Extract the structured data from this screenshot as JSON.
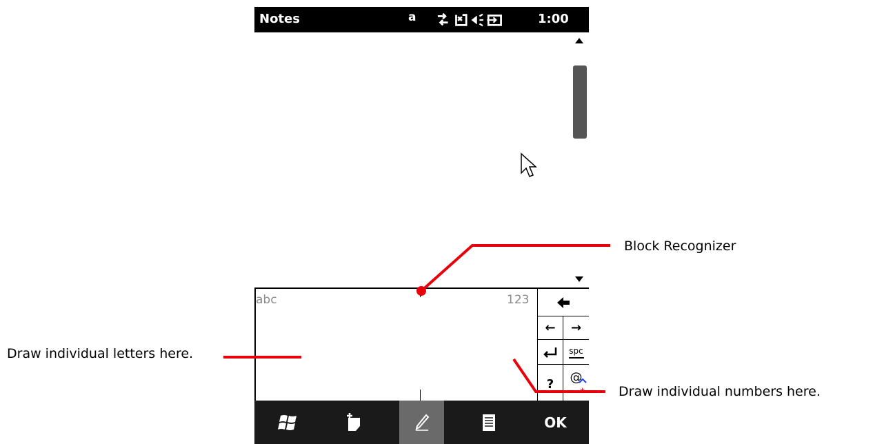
{
  "status_bar": {
    "app_title": "Notes",
    "input_mode": "a",
    "clock": "1:00",
    "icons": [
      "connectivity-icon",
      "no-signal-icon",
      "speaker-icon",
      "battery-charging-icon"
    ]
  },
  "input_panel": {
    "letters_label": "abc",
    "numbers_label": "123",
    "keys": {
      "backspace": "←",
      "left": "←",
      "right": "→",
      "enter": "↵",
      "space": "spc",
      "help": "?",
      "symbols": "@"
    }
  },
  "menu_bar": {
    "ok_label": "OK"
  },
  "annotations": {
    "block_recognizer": "Block Recognizer",
    "letters": "Draw individual letters here.",
    "numbers": "Draw individual numbers here."
  },
  "colors": {
    "callout": "#e8000b",
    "status_bar_bg": "#000000",
    "menu_bar_bg": "#1a1a1a",
    "label_gray": "#8a8a8a"
  }
}
